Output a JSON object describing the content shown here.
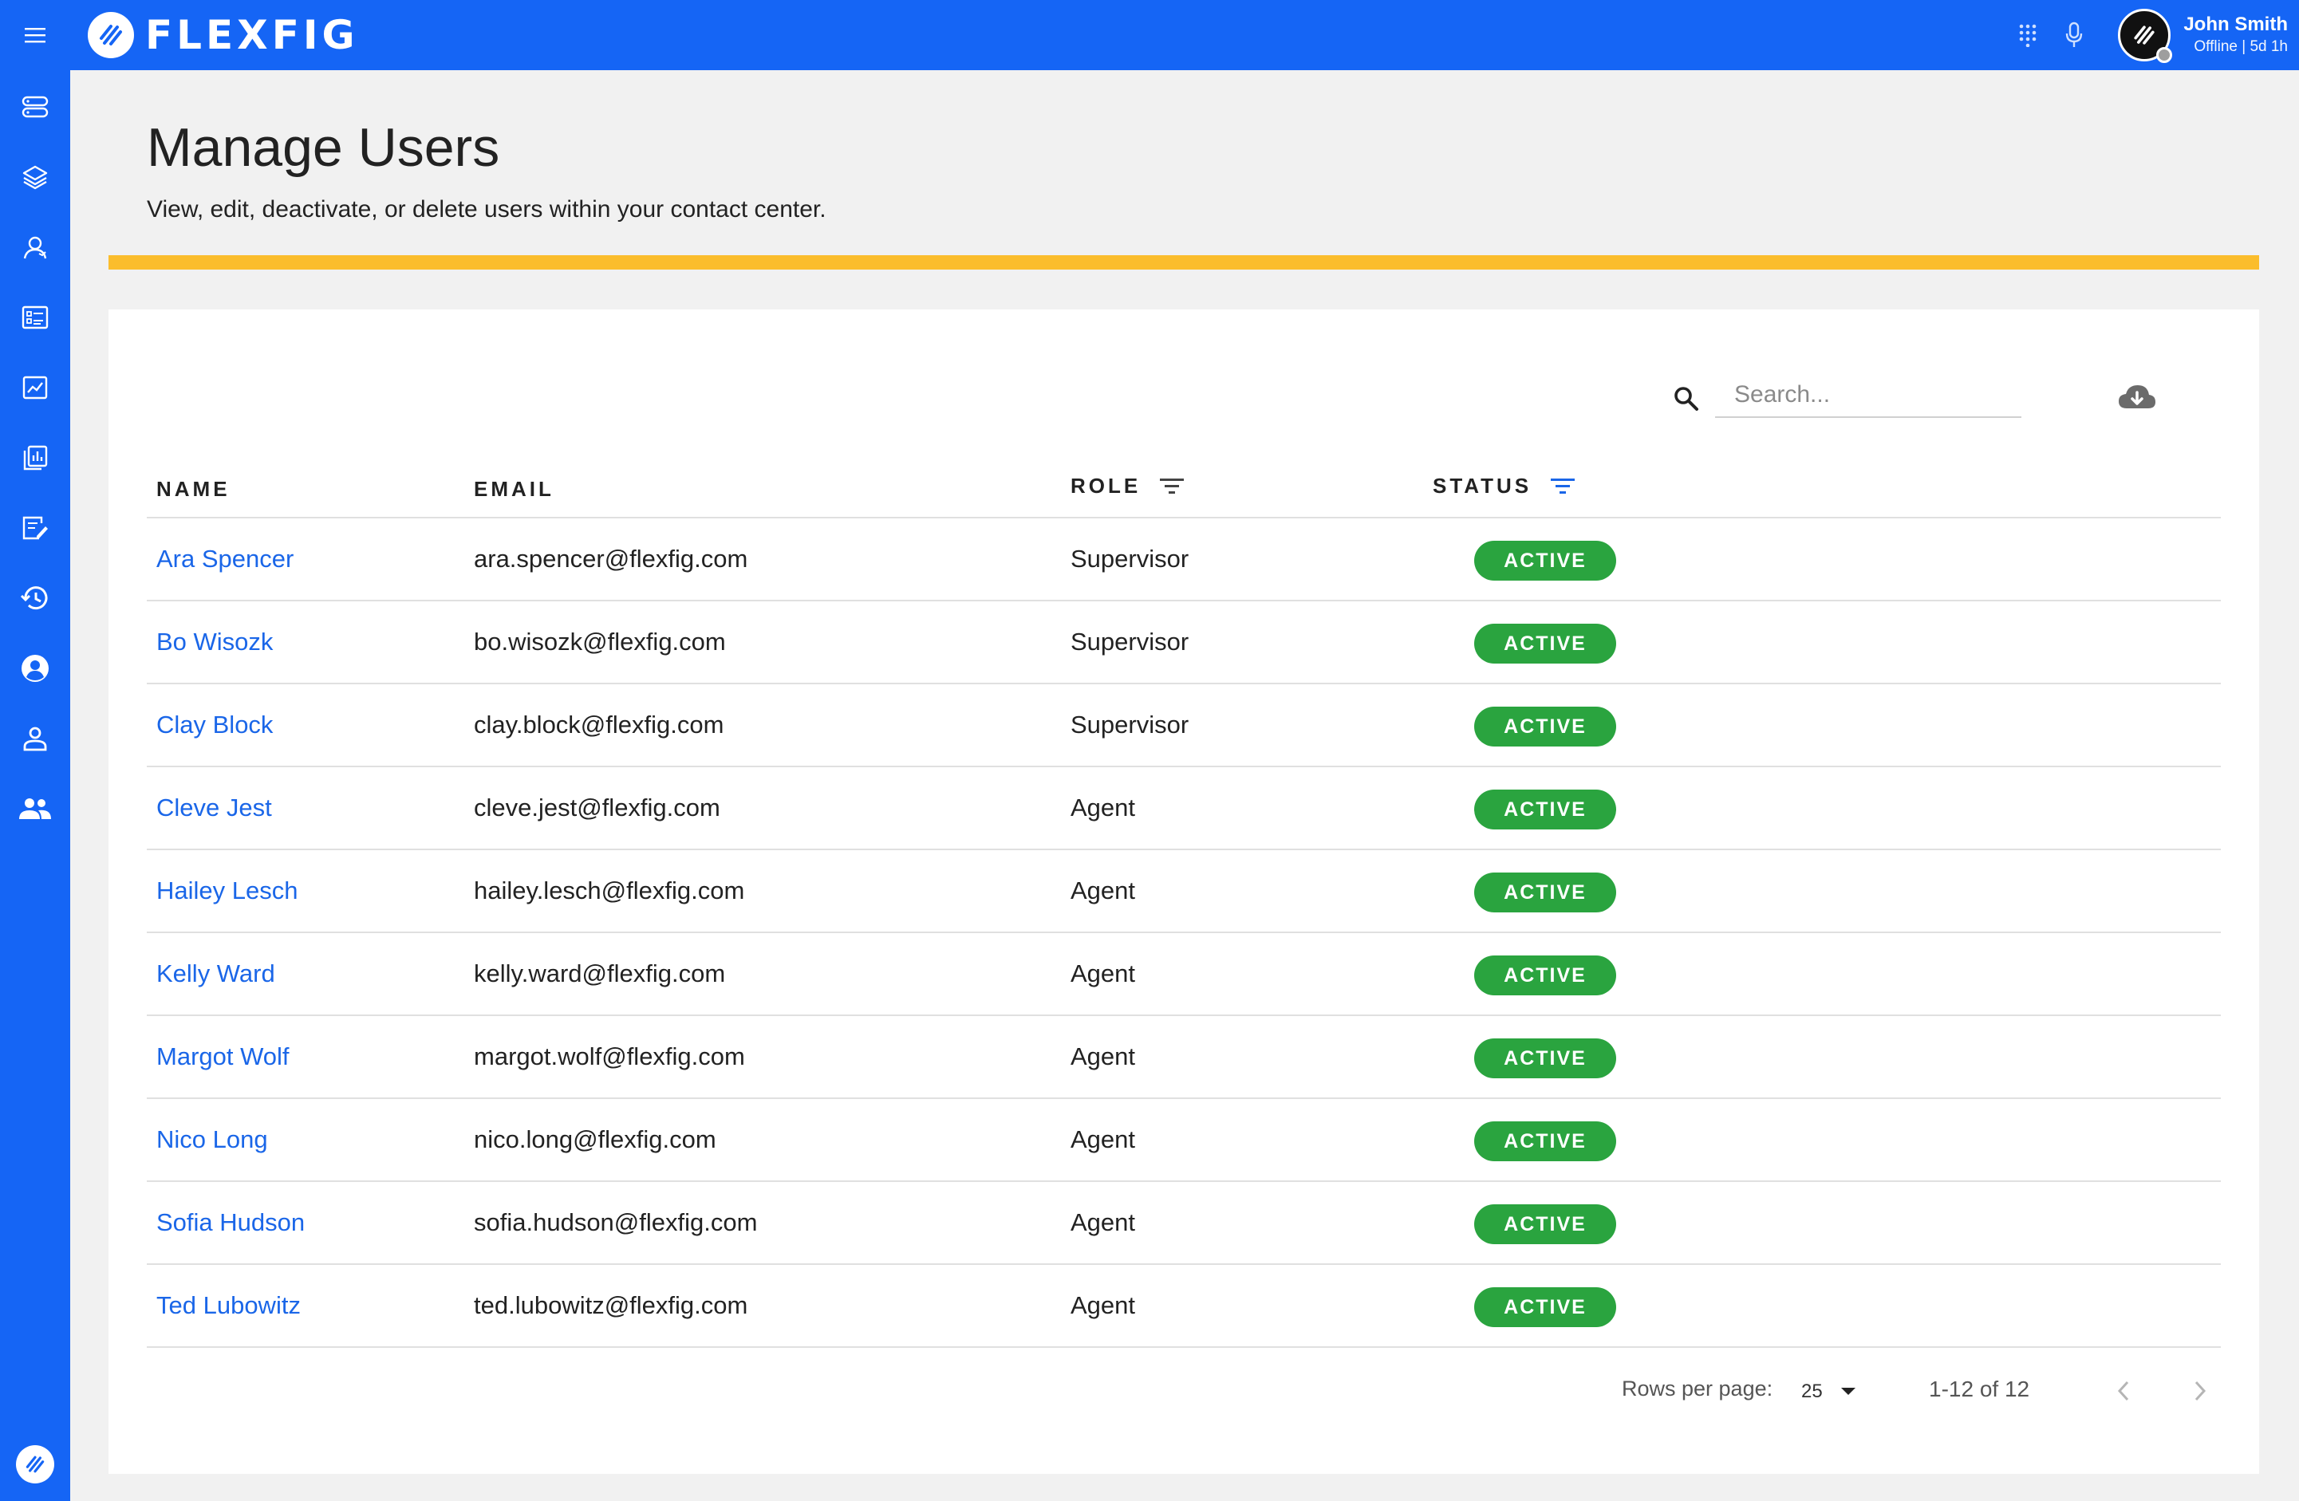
{
  "app": {
    "brand": "FLEXFIG"
  },
  "user": {
    "name": "John Smith",
    "status": "Offline | 5d 1h"
  },
  "page": {
    "title": "Manage Users",
    "subtitle": "View, edit, deactivate, or delete users within your contact center."
  },
  "search": {
    "placeholder": "Search..."
  },
  "table": {
    "headers": {
      "name": "NAME",
      "email": "EMAIL",
      "role": "ROLE",
      "status": "STATUS"
    },
    "rows": [
      {
        "name": "Ara Spencer",
        "email": "ara.spencer@flexfig.com",
        "role": "Supervisor",
        "status": "ACTIVE"
      },
      {
        "name": "Bo Wisozk",
        "email": "bo.wisozk@flexfig.com",
        "role": "Supervisor",
        "status": "ACTIVE"
      },
      {
        "name": "Clay Block",
        "email": "clay.block@flexfig.com",
        "role": "Supervisor",
        "status": "ACTIVE"
      },
      {
        "name": "Cleve Jest",
        "email": "cleve.jest@flexfig.com",
        "role": "Agent",
        "status": "ACTIVE"
      },
      {
        "name": "Hailey Lesch",
        "email": "hailey.lesch@flexfig.com",
        "role": "Agent",
        "status": "ACTIVE"
      },
      {
        "name": "Kelly Ward",
        "email": "kelly.ward@flexfig.com",
        "role": "Agent",
        "status": "ACTIVE"
      },
      {
        "name": "Margot Wolf",
        "email": "margot.wolf@flexfig.com",
        "role": "Agent",
        "status": "ACTIVE"
      },
      {
        "name": "Nico Long",
        "email": "nico.long@flexfig.com",
        "role": "Agent",
        "status": "ACTIVE"
      },
      {
        "name": "Sofia Hudson",
        "email": "sofia.hudson@flexfig.com",
        "role": "Agent",
        "status": "ACTIVE"
      },
      {
        "name": "Ted Lubowitz",
        "email": "ted.lubowitz@flexfig.com",
        "role": "Agent",
        "status": "ACTIVE"
      }
    ]
  },
  "pagination": {
    "rows_per_page_label": "Rows per page:",
    "rows_per_page": "25",
    "range": "1-12 of 12"
  },
  "colors": {
    "primary": "#1565f5",
    "accent": "#fbbd2c",
    "active": "#2aa43f",
    "link": "#1a66e8"
  },
  "icons": {
    "topbar": [
      "menu-icon",
      "dialpad-icon",
      "microphone-icon"
    ],
    "sidebar": [
      "servers-icon",
      "layers-icon",
      "contacts-icon",
      "list-detail-icon",
      "analytics-icon",
      "reports-icon",
      "edit-note-icon",
      "history-icon",
      "account-circle-icon",
      "person-icon",
      "group-icon"
    ]
  }
}
